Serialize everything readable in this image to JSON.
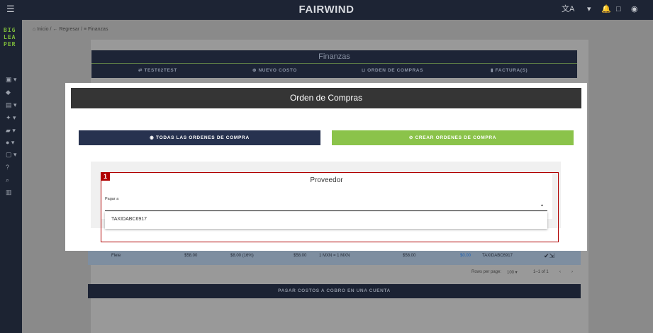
{
  "app": {
    "title": "FAIRWIND"
  },
  "sidebar": {
    "logo_lines": [
      "BIG",
      "LEA",
      "PER"
    ]
  },
  "breadcrumb": {
    "home": "Inicio",
    "sep1": "/",
    "back": "Regresar",
    "sep2": "/",
    "current": "Finanzas"
  },
  "finanzas": {
    "title": "Finanzas",
    "tabs": [
      {
        "label": "TEST02TEST",
        "icon": "swap-icon"
      },
      {
        "label": "NUEVO COSTO",
        "icon": "plus-circle-icon"
      },
      {
        "label": "ORDEN DE COMPRAS",
        "icon": "basket-icon"
      },
      {
        "label": "FACTURA(S)",
        "icon": "document-icon"
      }
    ]
  },
  "table_row": {
    "concept": "Flete",
    "c2": "$58.00",
    "c3": "$8.00 (16%)",
    "c4": "$58.00",
    "c5": "1 MXN = 1 MXN",
    "c6": "$58.00",
    "c7": "$0.00",
    "c8": "TAXIDABC6917"
  },
  "pagination": {
    "rows_label": "Rows per page:",
    "rows_value": "100",
    "range": "1–1 of 1"
  },
  "bottom_button": {
    "label": "PASAR COSTOS A COBRO EN UNA CUENTA"
  },
  "modal": {
    "title": "Orden de Compras",
    "btn_all": {
      "label": "TODAS LAS ORDENES DE COMPRA",
      "icon": "eye-icon"
    },
    "btn_create": {
      "label": "CREAR ORDENES DE COMPRA",
      "icon": "eye-off-icon"
    },
    "provider": {
      "title": "Proveedor",
      "field_label": "Pagar a",
      "options": [
        "TAXIDABC6917"
      ]
    }
  },
  "annotation": {
    "badge": "1"
  },
  "colors": {
    "accent_green": "#8bc34a",
    "navy": "#27324f",
    "highlight_red": "#b00000"
  }
}
